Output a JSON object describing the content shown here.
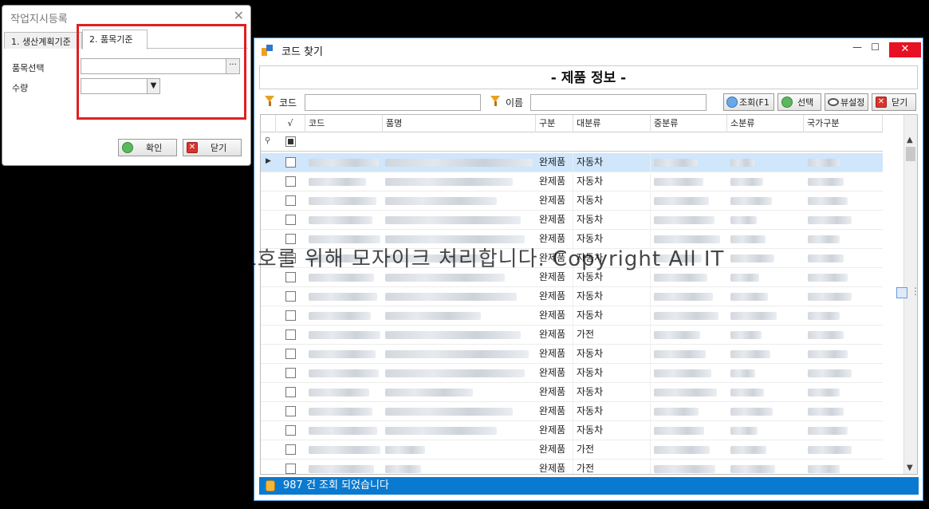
{
  "dialog1": {
    "title": "작업지시등록",
    "close_glyph": "✕",
    "tabs": [
      "1. 생산계획기준",
      "2. 품목기준"
    ],
    "item_label": "품목선택",
    "qty_label": "수량",
    "ellipsis": "···",
    "confirm_label": "확인",
    "close_label": "닫기"
  },
  "dialog2": {
    "title": "코드 찾기",
    "heading": "- 제품 정보 -",
    "code_label": "코드",
    "name_label": "이름",
    "buttons": {
      "search": "조회(F1",
      "select": "선택",
      "view": "뷰설정",
      "close": "닫기"
    },
    "columns": [
      "√",
      "코드",
      "품명",
      "구분",
      "대분류",
      "중분류",
      "소분류",
      "국가구분"
    ],
    "rows": [
      {
        "type": "완제품",
        "category": "자동차"
      },
      {
        "type": "완제품",
        "category": "자동차"
      },
      {
        "type": "완제품",
        "category": "자동차"
      },
      {
        "type": "완제품",
        "category": "자동차"
      },
      {
        "type": "완제품",
        "category": "자동차"
      },
      {
        "type": "완제품",
        "category": "자동차"
      },
      {
        "type": "완제품",
        "category": "자동차"
      },
      {
        "type": "완제품",
        "category": "자동차"
      },
      {
        "type": "완제품",
        "category": "자동차"
      },
      {
        "type": "완제품",
        "category": "가전"
      },
      {
        "type": "완제품",
        "category": "자동차"
      },
      {
        "type": "완제품",
        "category": "자동차"
      },
      {
        "type": "완제품",
        "category": "자동차"
      },
      {
        "type": "완제품",
        "category": "자동차"
      },
      {
        "type": "완제품",
        "category": "자동차"
      },
      {
        "type": "완제품",
        "category": "가전"
      },
      {
        "type": "완제품",
        "category": "가전"
      }
    ],
    "status_text": "987 건 조회 되었습니다"
  },
  "watermark": "자료보호를 위해 모자이크 처리합니다. Copyright All IT",
  "colors": {
    "accent": "#0a7ad0",
    "highlight_box": "#e02020",
    "close_red": "#e81123"
  }
}
